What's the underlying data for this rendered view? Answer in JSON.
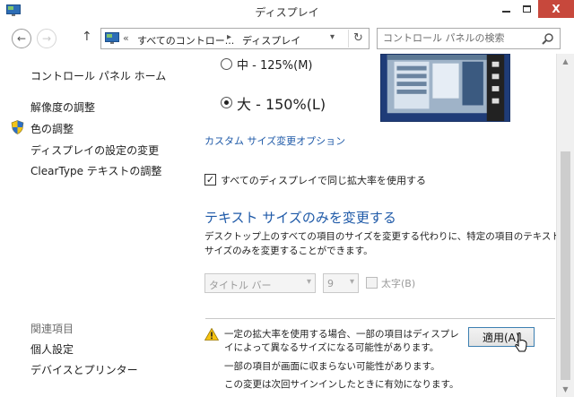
{
  "window": {
    "title": "ディスプレイ",
    "close_glyph": "X"
  },
  "nav": {
    "back_glyph": "←",
    "forward_glyph": "→",
    "up_glyph": "↑",
    "breadcrumb_chevron": "«",
    "breadcrumb": [
      "すべてのコントロー...",
      "ディスプレイ"
    ],
    "breadcrumb_separator": "▸",
    "dropdown_glyph": "▾",
    "refresh_glyph": "↻",
    "search_placeholder": "コントロール パネルの検索"
  },
  "sidebar": {
    "items": [
      "コントロール パネル ホーム",
      "解像度の調整",
      "色の調整",
      "ディスプレイの設定の変更",
      "ClearType テキストの調整"
    ],
    "related_heading": "関連項目",
    "related_items": [
      "個人設定",
      "デバイスとプリンター"
    ]
  },
  "main": {
    "radio_options": [
      {
        "label": "中 - 125%(M)",
        "checked": false
      },
      {
        "label": "大 - 150%(L)",
        "checked": true
      }
    ],
    "custom_link": "カスタム サイズ変更オプション",
    "same_scale_checkbox": {
      "label": "すべてのディスプレイで同じ拡大率を使用する",
      "checked": true,
      "check_glyph": "✓"
    },
    "text_size_heading": "テキスト サイズのみを変更する",
    "text_size_description": [
      "デスクトップ上のすべての項目のサイズを変更する代わりに、特定の項目のテキスト",
      "サイズのみを変更することができます。"
    ],
    "item_select": "タイトル バー",
    "size_select": "9",
    "bold_checkbox": {
      "label": "太字(B)",
      "checked": false
    },
    "warnings": [
      "一定の拡大率を使用する場合、一部の項目はディスプレ",
      "イによって異なるサイズになる可能性があります。",
      "一部の項目が画面に収まらない可能性があります。",
      "この変更は次回サインインしたときに有効になります。"
    ],
    "apply_button": "適用(A)"
  },
  "colors": {
    "accent": "#1f5aa8",
    "close_button": "#c7483c",
    "preview_background": "#1f3c78"
  }
}
